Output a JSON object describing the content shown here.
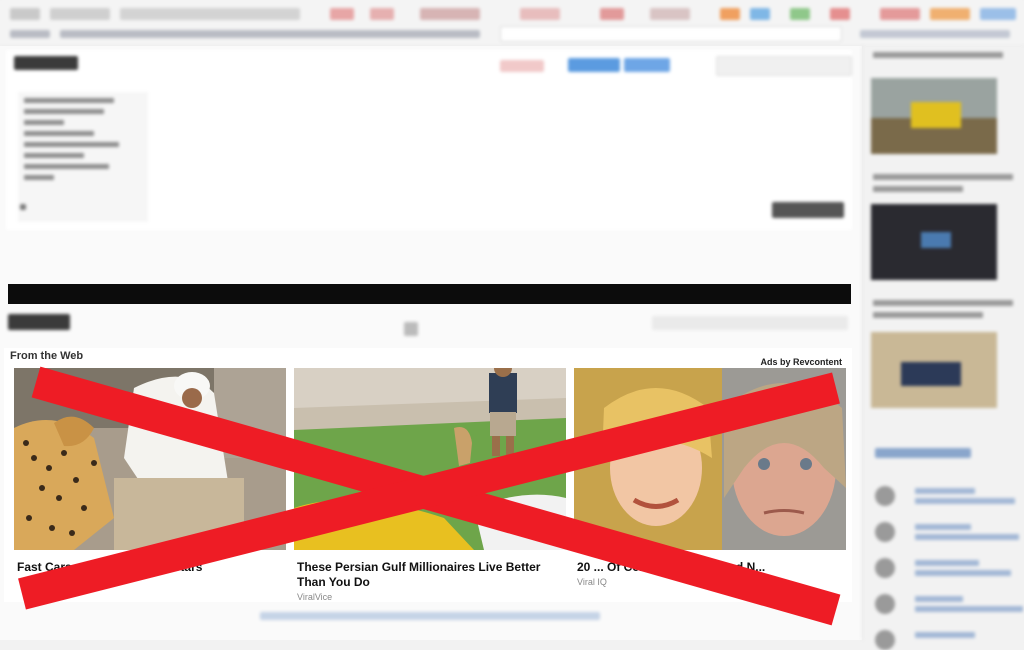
{
  "widget": {
    "title": "From the Web",
    "ads_label": "Ads by Revcontent",
    "items": [
      {
        "title": "Fast Cars... These ...agram Stars",
        "source": ""
      },
      {
        "title": "These Persian Gulf Millionaires Live Better Than You Do",
        "source": "ViralVice"
      },
      {
        "title": "20 ... Of Celebrities Then And N...",
        "source": "Viral IQ"
      }
    ]
  },
  "colors": {
    "cross_red": "#ee1c25",
    "black_bar": "#0c0c0c",
    "link_blue": "#aec4de"
  },
  "overlay": {
    "icon": "red-x-cross-icon"
  }
}
